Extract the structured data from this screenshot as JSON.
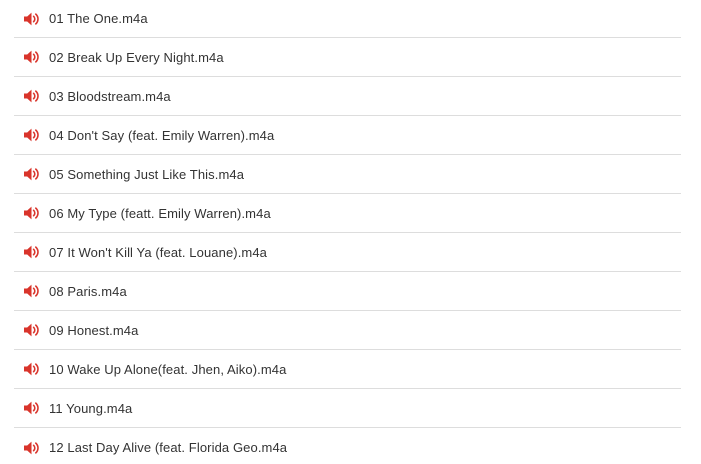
{
  "colors": {
    "icon": "#d9342b",
    "text": "#333333",
    "divider": "#dddddd"
  },
  "tracks": [
    {
      "label": "01 The One.m4a",
      "icon": "speaker-icon"
    },
    {
      "label": "02 Break Up Every Night.m4a",
      "icon": "speaker-icon"
    },
    {
      "label": "03 Bloodstream.m4a",
      "icon": "speaker-icon"
    },
    {
      "label": "04 Don't Say (feat. Emily Warren).m4a",
      "icon": "speaker-icon"
    },
    {
      "label": "05 Something Just Like This.m4a",
      "icon": "speaker-icon"
    },
    {
      "label": "06 My Type (featt. Emily Warren).m4a",
      "icon": "speaker-icon"
    },
    {
      "label": "07 It Won't Kill Ya (feat. Louane).m4a",
      "icon": "speaker-icon"
    },
    {
      "label": "08 Paris.m4a",
      "icon": "speaker-icon"
    },
    {
      "label": "09 Honest.m4a",
      "icon": "speaker-icon"
    },
    {
      "label": "10 Wake Up Alone(feat. Jhen, Aiko).m4a",
      "icon": "speaker-icon"
    },
    {
      "label": "11 Young.m4a",
      "icon": "speaker-icon"
    },
    {
      "label": "12 Last Day Alive (feat. Florida Geo.m4a",
      "icon": "speaker-icon"
    }
  ]
}
